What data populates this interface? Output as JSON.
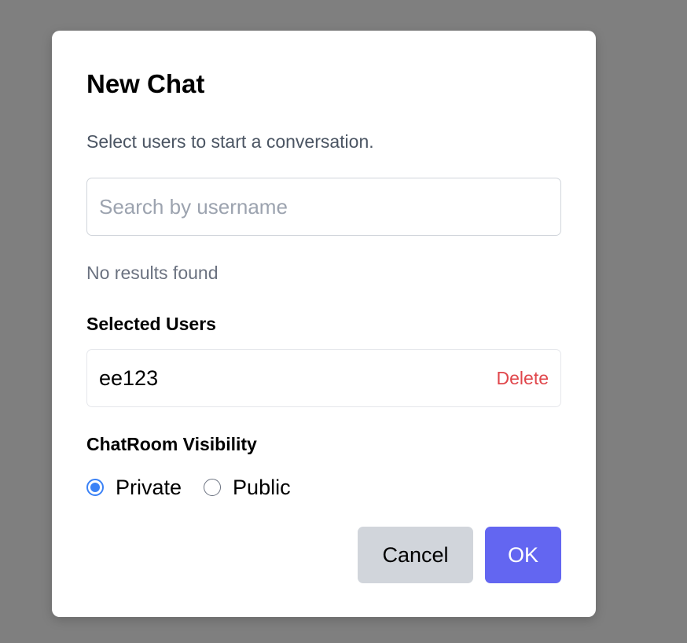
{
  "dialog": {
    "title": "New Chat",
    "subtitle": "Select users to start a conversation."
  },
  "search": {
    "value": "",
    "placeholder": "Search by username",
    "no_results_text": "No results found"
  },
  "selected_users": {
    "heading": "Selected Users",
    "items": [
      {
        "username": "ee123",
        "delete_label": "Delete"
      }
    ]
  },
  "visibility": {
    "heading": "ChatRoom Visibility",
    "selected": "Private",
    "options": [
      {
        "label": "Private",
        "checked": true
      },
      {
        "label": "Public",
        "checked": false
      }
    ]
  },
  "actions": {
    "cancel_label": "Cancel",
    "ok_label": "OK"
  },
  "colors": {
    "overlay": "#7f7f7f",
    "primary": "#6366f1",
    "danger": "#e0464b",
    "radio_accent": "#3b82f6",
    "secondary_button": "#d1d5db"
  }
}
